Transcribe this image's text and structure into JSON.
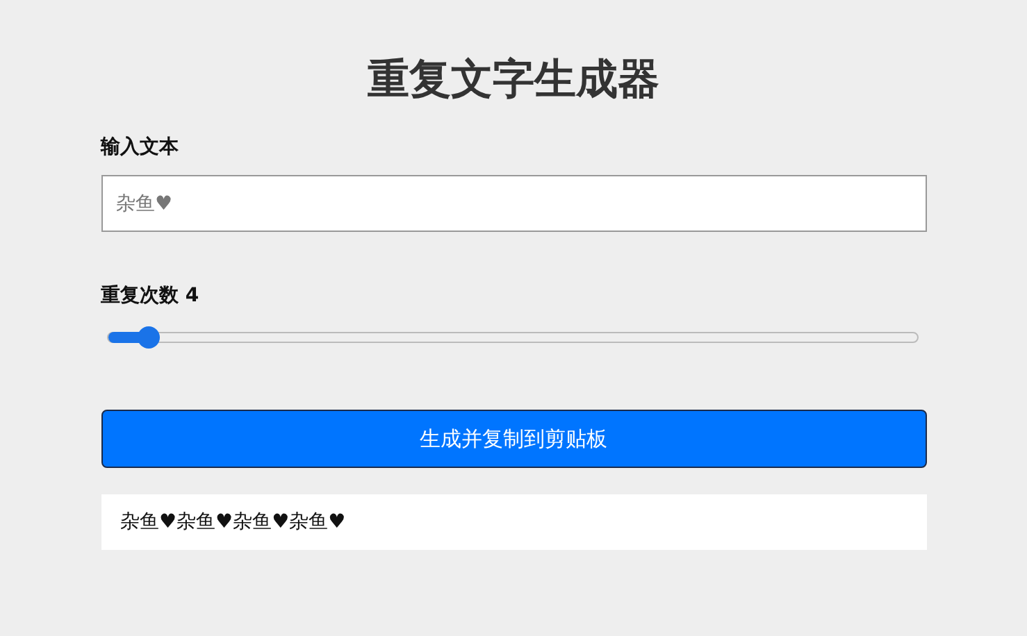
{
  "title": "重复文字生成器",
  "text_field": {
    "label": "输入文本",
    "placeholder": "杂鱼♥"
  },
  "repeat_slider": {
    "label": "重复次数 4",
    "level": 0.05
  },
  "generate_button": "生成并复制到剪贴板",
  "output": "杂鱼♥杂鱼♥杂鱼♥杂鱼♥"
}
